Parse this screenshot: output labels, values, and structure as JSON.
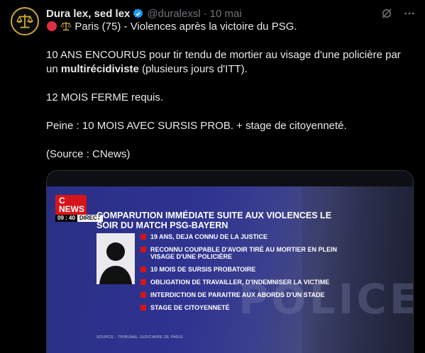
{
  "tweet": {
    "author_name": "Dura lex, sed lex",
    "handle": "@duralexsl",
    "separator": "·",
    "date": "10 mai",
    "line1": "Paris (75) - Violences après la victoire du PSG.",
    "para2_part1": "10 ANS ENCOURUS pour tir tendu de mortier au visage d'une policière par un ",
    "para2_bold": "multirécidiviste",
    "para2_part2": " (plusieurs jours d'ITT).",
    "para3": "12 MOIS FERME requis.",
    "para4": "Peine : 10 MOIS AVEC SURSIS PROB. + stage de citoyenneté.",
    "para5": "(Source : CNews)"
  },
  "media": {
    "logo": "C NEWS",
    "time": "09 : 40",
    "live": "DIRECT",
    "headline": "COMPARUTION IMMÉDIATE SUITE AUX VIOLENCES LE SOIR DU MATCH PSG-BAYERN",
    "items": [
      "19 ANS, DEJA CONNU DE LA JUSTICE",
      "RECONNU COUPABLE D'AVOIR TIRÉ AU MORTIER EN PLEIN VISAGE D'UNE POLICIÈRE",
      "10 MOIS DE SURSIS PROBATOIRE",
      "OBLIGATION DE TRAVAILLER, D'INDEMNISER LA VICTIME",
      "INTERDICTION DE PARAITRE AUX ABORDS D'UN STADE",
      "STAGE DE CITOYENNETÉ"
    ],
    "source": "SOURCE : TRIBUNAL JUDICIAIRE DE PARIS",
    "background_text": "POLICE"
  },
  "colors": {
    "accent_red": "#d7141a",
    "verified_blue": "#1d9bf0",
    "muted": "#71767b"
  },
  "icons": [
    "scales-avatar-icon",
    "verified-badge-icon",
    "grok-icon",
    "more-icon",
    "red-circle-icon",
    "scales-icon"
  ]
}
